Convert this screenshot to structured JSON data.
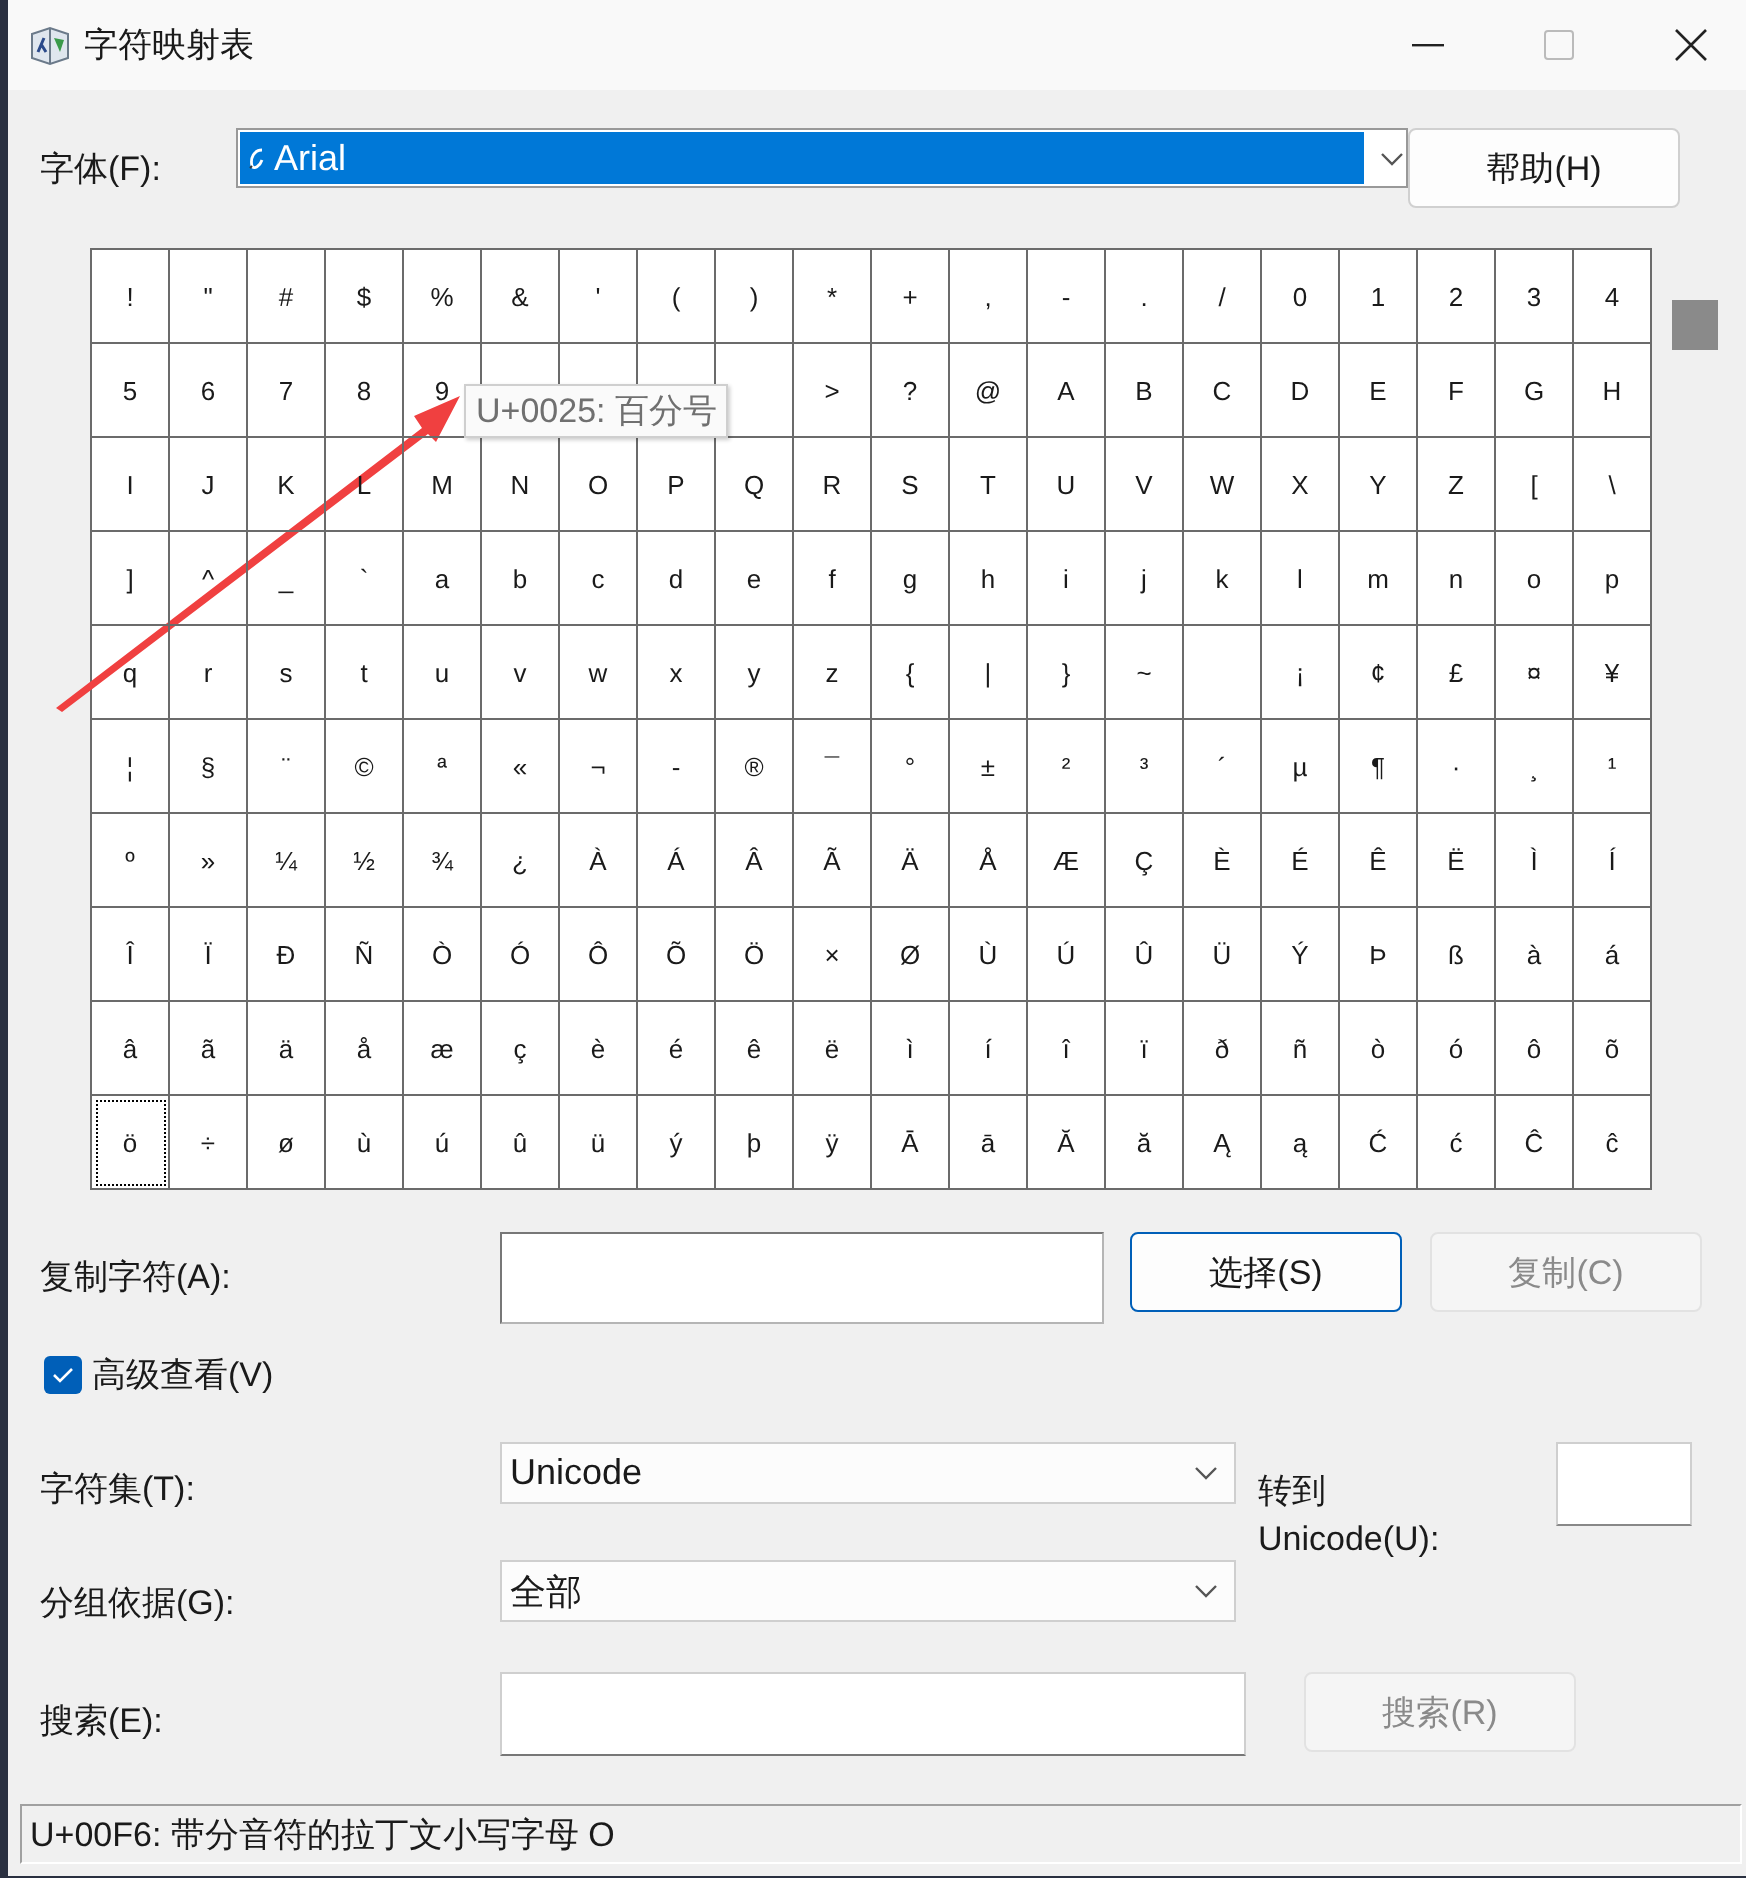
{
  "window": {
    "title": "字符映射表"
  },
  "font": {
    "label": "字体(F):",
    "value": "Arial"
  },
  "help_button": {
    "label": "帮助(H)",
    "disabled": false,
    "focused": false
  },
  "grid": {
    "rows": [
      [
        {
          "c": "!",
          "selected": false
        },
        {
          "c": "\"",
          "selected": false
        },
        {
          "c": "#",
          "selected": false
        },
        {
          "c": "$",
          "selected": false
        },
        {
          "c": "%",
          "selected": false
        },
        {
          "c": "&",
          "selected": false
        },
        {
          "c": "'",
          "selected": false
        },
        {
          "c": "(",
          "selected": false
        },
        {
          "c": ")",
          "selected": false
        },
        {
          "c": "*",
          "selected": false
        },
        {
          "c": "+",
          "selected": false
        },
        {
          "c": ",",
          "selected": false
        },
        {
          "c": "-",
          "selected": false
        },
        {
          "c": ".",
          "selected": false
        },
        {
          "c": "/",
          "selected": false
        },
        {
          "c": "0",
          "selected": false
        },
        {
          "c": "1",
          "selected": false
        },
        {
          "c": "2",
          "selected": false
        },
        {
          "c": "3",
          "selected": false
        },
        {
          "c": "4",
          "selected": false
        }
      ],
      [
        {
          "c": "5",
          "selected": false
        },
        {
          "c": "6",
          "selected": false
        },
        {
          "c": "7",
          "selected": false
        },
        {
          "c": "8",
          "selected": false
        },
        {
          "c": "9",
          "selected": false
        },
        {
          "selected": false
        },
        {
          "selected": false
        },
        {
          "selected": false
        },
        {
          "selected": false
        },
        {
          "c": ">",
          "selected": false
        },
        {
          "c": "?",
          "selected": false
        },
        {
          "c": "@",
          "selected": false
        },
        {
          "c": "A",
          "selected": false
        },
        {
          "c": "B",
          "selected": false
        },
        {
          "c": "C",
          "selected": false
        },
        {
          "c": "D",
          "selected": false
        },
        {
          "c": "E",
          "selected": false
        },
        {
          "c": "F",
          "selected": false
        },
        {
          "c": "G",
          "selected": false
        },
        {
          "c": "H",
          "selected": false
        }
      ],
      [
        {
          "c": "I",
          "selected": false
        },
        {
          "c": "J",
          "selected": false
        },
        {
          "c": "K",
          "selected": false
        },
        {
          "c": "L",
          "selected": false
        },
        {
          "c": "M",
          "selected": false
        },
        {
          "c": "N",
          "selected": false
        },
        {
          "c": "O",
          "selected": false
        },
        {
          "c": "P",
          "selected": false
        },
        {
          "c": "Q",
          "selected": false
        },
        {
          "c": "R",
          "selected": false
        },
        {
          "c": "S",
          "selected": false
        },
        {
          "c": "T",
          "selected": false
        },
        {
          "c": "U",
          "selected": false
        },
        {
          "c": "V",
          "selected": false
        },
        {
          "c": "W",
          "selected": false
        },
        {
          "c": "X",
          "selected": false
        },
        {
          "c": "Y",
          "selected": false
        },
        {
          "c": "Z",
          "selected": false
        },
        {
          "c": "[",
          "selected": false
        },
        {
          "c": "\\",
          "selected": false
        }
      ],
      [
        {
          "c": "]",
          "selected": false
        },
        {
          "c": "^",
          "selected": false
        },
        {
          "c": "_",
          "selected": false
        },
        {
          "c": "`",
          "selected": false
        },
        {
          "c": "a",
          "selected": false
        },
        {
          "c": "b",
          "selected": false
        },
        {
          "c": "c",
          "selected": false
        },
        {
          "c": "d",
          "selected": false
        },
        {
          "c": "e",
          "selected": false
        },
        {
          "c": "f",
          "selected": false
        },
        {
          "c": "g",
          "selected": false
        },
        {
          "c": "h",
          "selected": false
        },
        {
          "c": "i",
          "selected": false
        },
        {
          "c": "j",
          "selected": false
        },
        {
          "c": "k",
          "selected": false
        },
        {
          "c": "l",
          "selected": false
        },
        {
          "c": "m",
          "selected": false
        },
        {
          "c": "n",
          "selected": false
        },
        {
          "c": "o",
          "selected": false
        },
        {
          "c": "p",
          "selected": false
        }
      ],
      [
        {
          "c": "q",
          "selected": false
        },
        {
          "c": "r",
          "selected": false
        },
        {
          "c": "s",
          "selected": false
        },
        {
          "c": "t",
          "selected": false
        },
        {
          "c": "u",
          "selected": false
        },
        {
          "c": "v",
          "selected": false
        },
        {
          "c": "w",
          "selected": false
        },
        {
          "c": "x",
          "selected": false
        },
        {
          "c": "y",
          "selected": false
        },
        {
          "c": "z",
          "selected": false
        },
        {
          "c": "{",
          "selected": false
        },
        {
          "c": "|",
          "selected": false
        },
        {
          "c": "}",
          "selected": false
        },
        {
          "c": "~",
          "selected": false
        },
        {
          "selected": false
        },
        {
          "c": "¡",
          "selected": false
        },
        {
          "c": "¢",
          "selected": false
        },
        {
          "c": "£",
          "selected": false
        },
        {
          "c": "¤",
          "selected": false
        },
        {
          "c": "¥",
          "selected": false
        }
      ],
      [
        {
          "c": "¦",
          "selected": false
        },
        {
          "c": "§",
          "selected": false
        },
        {
          "c": "¨",
          "selected": false
        },
        {
          "c": "©",
          "selected": false
        },
        {
          "c": "ª",
          "selected": false
        },
        {
          "c": "«",
          "selected": false
        },
        {
          "c": "¬",
          "selected": false
        },
        {
          "c": "-",
          "selected": false
        },
        {
          "c": "®",
          "selected": false
        },
        {
          "c": "¯",
          "selected": false
        },
        {
          "c": "°",
          "selected": false
        },
        {
          "c": "±",
          "selected": false
        },
        {
          "c": "²",
          "selected": false
        },
        {
          "c": "³",
          "selected": false
        },
        {
          "c": "´",
          "selected": false
        },
        {
          "c": "µ",
          "selected": false
        },
        {
          "c": "¶",
          "selected": false
        },
        {
          "c": "·",
          "selected": false
        },
        {
          "c": "¸",
          "selected": false
        },
        {
          "c": "¹",
          "selected": false
        }
      ],
      [
        {
          "c": "º",
          "selected": false
        },
        {
          "c": "»",
          "selected": false
        },
        {
          "c": "¼",
          "selected": false
        },
        {
          "c": "½",
          "selected": false
        },
        {
          "c": "¾",
          "selected": false
        },
        {
          "c": "¿",
          "selected": false
        },
        {
          "c": "À",
          "selected": false
        },
        {
          "c": "Á",
          "selected": false
        },
        {
          "c": "Â",
          "selected": false
        },
        {
          "c": "Ã",
          "selected": false
        },
        {
          "c": "Ä",
          "selected": false
        },
        {
          "c": "Å",
          "selected": false
        },
        {
          "c": "Æ",
          "selected": false
        },
        {
          "c": "Ç",
          "selected": false
        },
        {
          "c": "È",
          "selected": false
        },
        {
          "c": "É",
          "selected": false
        },
        {
          "c": "Ê",
          "selected": false
        },
        {
          "c": "Ë",
          "selected": false
        },
        {
          "c": "Ì",
          "selected": false
        },
        {
          "c": "Í",
          "selected": false
        }
      ],
      [
        {
          "c": "Î",
          "selected": false
        },
        {
          "c": "Ï",
          "selected": false
        },
        {
          "c": "Ð",
          "selected": false
        },
        {
          "c": "Ñ",
          "selected": false
        },
        {
          "c": "Ò",
          "selected": false
        },
        {
          "c": "Ó",
          "selected": false
        },
        {
          "c": "Ô",
          "selected": false
        },
        {
          "c": "Õ",
          "selected": false
        },
        {
          "c": "Ö",
          "selected": false
        },
        {
          "c": "×",
          "selected": false
        },
        {
          "c": "Ø",
          "selected": false
        },
        {
          "c": "Ù",
          "selected": false
        },
        {
          "c": "Ú",
          "selected": false
        },
        {
          "c": "Û",
          "selected": false
        },
        {
          "c": "Ü",
          "selected": false
        },
        {
          "c": "Ý",
          "selected": false
        },
        {
          "c": "Þ",
          "selected": false
        },
        {
          "c": "ß",
          "selected": false
        },
        {
          "c": "à",
          "selected": false
        },
        {
          "c": "á",
          "selected": false
        }
      ],
      [
        {
          "c": "â",
          "selected": false
        },
        {
          "c": "ã",
          "selected": false
        },
        {
          "c": "ä",
          "selected": false
        },
        {
          "c": "å",
          "selected": false
        },
        {
          "c": "æ",
          "selected": false
        },
        {
          "c": "ç",
          "selected": false
        },
        {
          "c": "è",
          "selected": false
        },
        {
          "c": "é",
          "selected": false
        },
        {
          "c": "ê",
          "selected": false
        },
        {
          "c": "ë",
          "selected": false
        },
        {
          "c": "ì",
          "selected": false
        },
        {
          "c": "í",
          "selected": false
        },
        {
          "c": "î",
          "selected": false
        },
        {
          "c": "ï",
          "selected": false
        },
        {
          "c": "ð",
          "selected": false
        },
        {
          "c": "ñ",
          "selected": false
        },
        {
          "c": "ò",
          "selected": false
        },
        {
          "c": "ó",
          "selected": false
        },
        {
          "c": "ô",
          "selected": false
        },
        {
          "c": "õ",
          "selected": false
        }
      ],
      [
        {
          "c": "ö",
          "selected": true
        },
        {
          "c": "÷",
          "selected": false
        },
        {
          "c": "ø",
          "selected": false
        },
        {
          "c": "ù",
          "selected": false
        },
        {
          "c": "ú",
          "selected": false
        },
        {
          "c": "û",
          "selected": false
        },
        {
          "c": "ü",
          "selected": false
        },
        {
          "c": "ý",
          "selected": false
        },
        {
          "c": "þ",
          "selected": false
        },
        {
          "c": "ÿ",
          "selected": false
        },
        {
          "c": "Ā",
          "selected": false
        },
        {
          "c": "ā",
          "selected": false
        },
        {
          "c": "Ă",
          "selected": false
        },
        {
          "c": "ă",
          "selected": false
        },
        {
          "c": "Ą",
          "selected": false
        },
        {
          "c": "ą",
          "selected": false
        },
        {
          "c": "Ć",
          "selected": false
        },
        {
          "c": "ć",
          "selected": false
        },
        {
          "c": "Ĉ",
          "selected": false
        },
        {
          "c": "ĉ",
          "selected": false
        }
      ]
    ]
  },
  "tooltip": "U+0025: 百分号",
  "copy": {
    "label": "复制字符(A):",
    "select_button": {
      "label": "选择(S)",
      "disabled": false,
      "focused": true
    },
    "copy_button": {
      "label": "复制(C)",
      "disabled": true,
      "focused": false
    }
  },
  "advanced": {
    "label": "高级查看(V)",
    "checked": true
  },
  "charset": {
    "label": "字符集(T):",
    "value": "Unicode"
  },
  "group_by": {
    "label": "分组依据(G):",
    "value": "全部"
  },
  "goto_unicode": {
    "label": "转到 Unicode(U):"
  },
  "search": {
    "label": "搜索(E):",
    "button": {
      "label": "搜索(R)",
      "disabled": true,
      "focused": false
    }
  },
  "status_bar": "U+00F6: 带分音符的拉丁文小写字母 O"
}
